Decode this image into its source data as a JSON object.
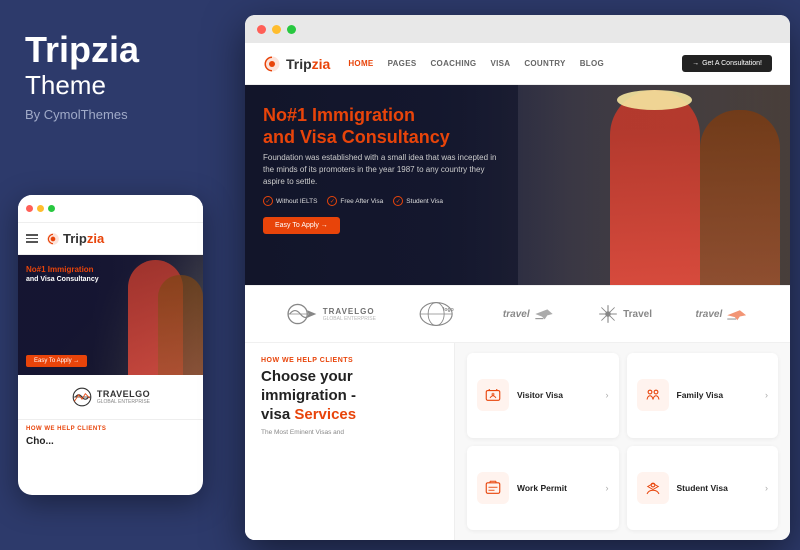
{
  "brand": {
    "name": "Tripzia",
    "subtitle": "Theme",
    "by": "By CymolThemes"
  },
  "colors": {
    "accent": "#e8440a",
    "dark": "#2d3a6b",
    "dot_red": "#ff5f57",
    "dot_yellow": "#ffbd2e",
    "dot_green": "#28c840"
  },
  "mobile": {
    "hero_line1": "No#1 Immigration",
    "hero_line2": "and Visa Consultancy",
    "hero_btn": "Easy To Apply →",
    "logo_text": "TRAVELGO",
    "section_label": "HOW WE HELP CLIENTS",
    "section_title": "Cho..."
  },
  "desktop": {
    "nav": {
      "logo": "Tripzia",
      "links": [
        "HOME",
        "PAGES",
        "COACHING",
        "VISA",
        "COUNTRY",
        "BLOG"
      ],
      "cta": "Get A Consultation!"
    },
    "hero": {
      "headline_line1": "No#1 Immigration",
      "headline_line2": "and Visa Consultancy",
      "description": "Foundation was established with a small idea that was incepted in the minds of its promoters in the year 1987 to any country they aspire to settle.",
      "badges": [
        "Without IELTS",
        "Free After Visa",
        "Student Visa"
      ],
      "cta": "Easy To Apply →"
    },
    "logos": [
      "TRAVELGO",
      "Travellogo",
      "travel",
      "Travel",
      "travel"
    ],
    "section": {
      "eyebrow": "HOW WE HELP CLIENTS",
      "heading_line1": "Choose your",
      "heading_line2": "immigration -",
      "heading_line3": "visa",
      "heading_accent": "Services",
      "description": "The Most Eminent Visas and"
    },
    "visa_cards": [
      {
        "name": "Visitor Visa",
        "icon": "visitor"
      },
      {
        "name": "Family Visa",
        "icon": "family"
      },
      {
        "name": "Work Permit",
        "icon": "work"
      },
      {
        "name": "Student Visa",
        "icon": "student"
      }
    ]
  }
}
